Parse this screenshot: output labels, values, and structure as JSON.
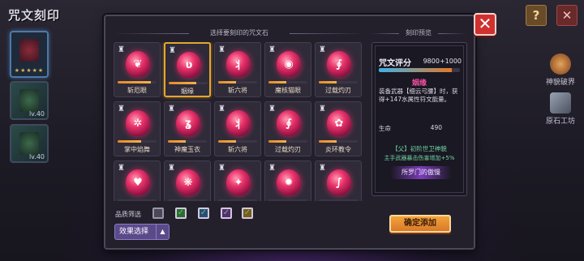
{
  "screen_title": "咒文刻印",
  "left_cards": [
    {
      "level": "",
      "stars": "★★★★★"
    },
    {
      "level": "lv.40"
    },
    {
      "level": "lv.40"
    }
  ],
  "top_buttons": {
    "help": "?",
    "close": "✕"
  },
  "right_entries": [
    "神貌破界",
    "原石工坊"
  ],
  "panel": {
    "close": "✕",
    "select_header": "选择要刻印的咒文石",
    "preview_header": "刻印预览"
  },
  "runes": [
    {
      "name": "斩厄眼",
      "glyph": "❦",
      "progress": 0.85,
      "selected": false,
      "row": 0,
      "col": 0
    },
    {
      "name": "姻缘",
      "glyph": "ʋ",
      "progress": 0.7,
      "selected": true,
      "row": 0,
      "col": 1
    },
    {
      "name": "斩六将",
      "glyph": "丬",
      "progress": 0.45,
      "selected": false,
      "row": 0,
      "col": 2
    },
    {
      "name": "魔核猫眼",
      "glyph": "◉",
      "progress": 0.45,
      "selected": false,
      "row": 0,
      "col": 3
    },
    {
      "name": "过载灼刃",
      "glyph": "∮",
      "progress": 0.45,
      "selected": false,
      "row": 0,
      "col": 4
    },
    {
      "name": "掌中焰舞",
      "glyph": "✲",
      "progress": 0.6,
      "selected": false,
      "row": 1,
      "col": 0
    },
    {
      "name": "神魔玉衣",
      "glyph": "ʓ",
      "progress": 0.45,
      "selected": false,
      "row": 1,
      "col": 1
    },
    {
      "name": "斩六将",
      "glyph": "丬",
      "progress": 0.45,
      "selected": false,
      "row": 1,
      "col": 2
    },
    {
      "name": "过载灼刃",
      "glyph": "∮",
      "progress": 0.45,
      "selected": false,
      "row": 1,
      "col": 3
    },
    {
      "name": "炎环教令",
      "glyph": "✿",
      "progress": 0.45,
      "selected": false,
      "row": 1,
      "col": 4
    },
    {
      "name": "",
      "glyph": "♥",
      "progress": 0,
      "selected": false,
      "row": 2,
      "col": 0
    },
    {
      "name": "",
      "glyph": "❋",
      "progress": 0,
      "selected": false,
      "row": 2,
      "col": 1
    },
    {
      "name": "",
      "glyph": "✦",
      "progress": 0,
      "selected": false,
      "row": 2,
      "col": 2
    },
    {
      "name": "",
      "glyph": "✹",
      "progress": 0,
      "selected": false,
      "row": 2,
      "col": 3
    },
    {
      "name": "",
      "glyph": "∫",
      "progress": 0,
      "selected": false,
      "row": 2,
      "col": 4
    }
  ],
  "preview": {
    "score_label": "咒文评分",
    "score_value": "9800+1000",
    "score_progress": 0.9,
    "rune_name": "姻缘",
    "description": "装备武器【细云弓腰】时，获得+147水属性符文能量。",
    "stat_label": "生命",
    "stat_value": "490",
    "set_name": "【父】初阶世卫神貌",
    "set_bonus": "主手武器暴击伤害增加+5%",
    "faction": "所罗门的傲慢"
  },
  "filter": {
    "label": "品质筛选",
    "checks": [
      "",
      "✓",
      "✓",
      "✓",
      "✓"
    ]
  },
  "effect_select": {
    "label": "效果选择",
    "arrow": "▲"
  },
  "confirm_button": "确定添加",
  "colors": {
    "accent_orange": "#e6a630",
    "close_red": "#d0312f",
    "rune_pink": "#e8336a",
    "preview_name": "#ef4fa0"
  }
}
